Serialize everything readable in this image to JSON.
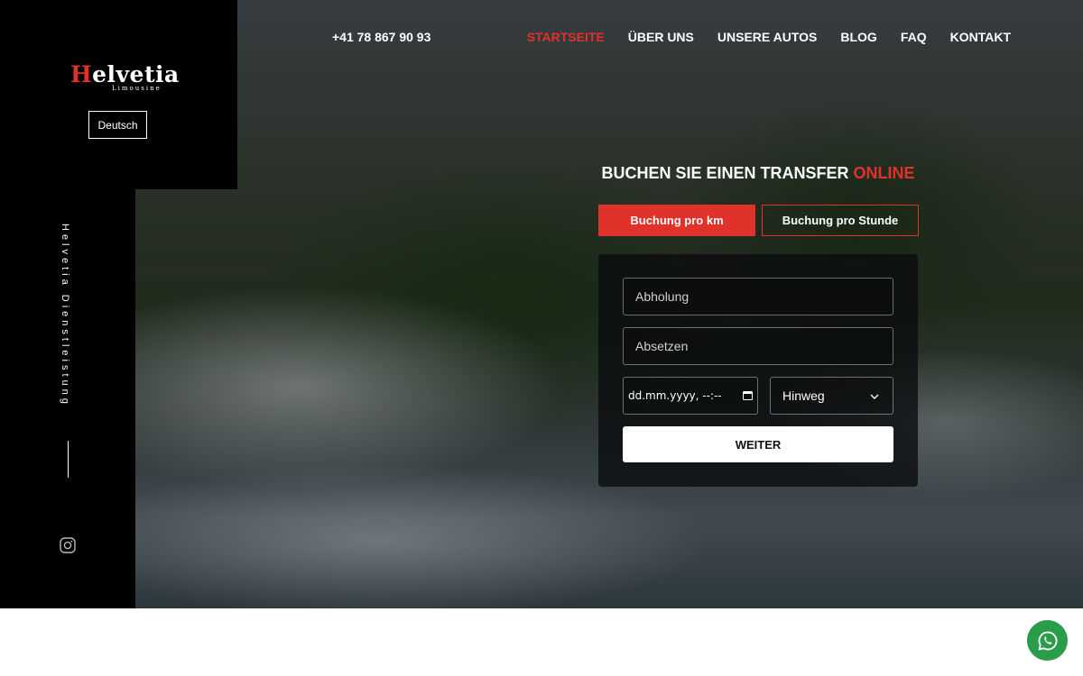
{
  "brand": {
    "logo_first_letter": "H",
    "logo_rest": "elvetia",
    "logo_sub": "Limousine"
  },
  "language_button": "Deutsch",
  "sidebar": {
    "vertical_text": "Helvetia Dienstleistung",
    "social_icon": "instagram-icon"
  },
  "header": {
    "phone": "+41 78 867 90 93",
    "nav": [
      {
        "label": "STARTSEITE",
        "active": true
      },
      {
        "label": "ÜBER UNS",
        "active": false
      },
      {
        "label": "UNSERE AUTOS",
        "active": false
      },
      {
        "label": "BLOG",
        "active": false
      },
      {
        "label": "FAQ",
        "active": false
      },
      {
        "label": "KONTAKT",
        "active": false
      }
    ]
  },
  "booking": {
    "title_main": "BUCHEN SIE EINEN TRANSFER ",
    "title_accent": "ONLINE",
    "tabs": [
      {
        "label": "Buchung pro km",
        "active": true
      },
      {
        "label": "Buchung pro Stunde",
        "active": false
      }
    ],
    "pickup_placeholder": "Abholung",
    "dropoff_placeholder": "Absetzen",
    "date_placeholder": "dd.mm.yyyy, --:--",
    "trip_type_selected": "Hinweg",
    "submit_label": "WEITER"
  },
  "floating": {
    "whatsapp_icon": "whatsapp-icon"
  },
  "colors": {
    "accent": "#e0312a",
    "whatsapp": "#2a9d4a",
    "panel": "#000000"
  }
}
